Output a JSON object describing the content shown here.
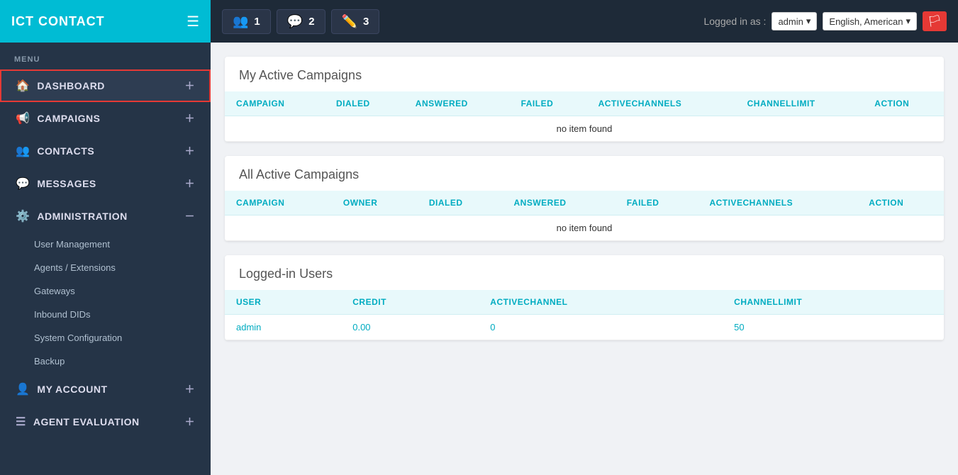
{
  "brand": {
    "title": "ICT CONTACT"
  },
  "header": {
    "nav_items": [
      {
        "icon": "👥",
        "count": "1",
        "id": "nav-users"
      },
      {
        "icon": "💬",
        "count": "2",
        "id": "nav-messages"
      },
      {
        "icon": "✏️",
        "count": "3",
        "id": "nav-edit"
      }
    ],
    "logged_in_label": "Logged in as :",
    "user": "admin",
    "language": "English, American"
  },
  "sidebar": {
    "menu_label": "MENU",
    "items": [
      {
        "id": "dashboard",
        "label": "DASHBOARD",
        "icon": "🏠",
        "action": "plus",
        "active": true
      },
      {
        "id": "campaigns",
        "label": "CAMPAIGNS",
        "icon": "📢",
        "action": "plus"
      },
      {
        "id": "contacts",
        "label": "CONTACTS",
        "icon": "👥",
        "action": "plus"
      },
      {
        "id": "messages",
        "label": "MESSAGES",
        "icon": "💬",
        "action": "plus"
      },
      {
        "id": "administration",
        "label": "ADMINISTRATION",
        "icon": "⚙️",
        "action": "minus"
      }
    ],
    "admin_sub_items": [
      {
        "id": "user-management",
        "label": "User Management"
      },
      {
        "id": "agents-extensions",
        "label": "Agents / Extensions"
      },
      {
        "id": "gateways",
        "label": "Gateways"
      },
      {
        "id": "inbound-dids",
        "label": "Inbound DIDs"
      },
      {
        "id": "system-configuration",
        "label": "System Configuration"
      },
      {
        "id": "backup",
        "label": "Backup"
      }
    ],
    "bottom_items": [
      {
        "id": "my-account",
        "label": "MY ACCOUNT",
        "icon": "👤",
        "action": "plus"
      },
      {
        "id": "agent-evaluation",
        "label": "AGENT EVALUATION",
        "icon": "☰",
        "action": "plus"
      }
    ]
  },
  "my_active_campaigns": {
    "title": "My Active Campaigns",
    "columns": [
      "CAMPAIGN",
      "DIALED",
      "ANSWERED",
      "FAILED",
      "ACTIVECHANNELS",
      "CHANNELLIMIT",
      "ACTION"
    ],
    "no_item_text": "no item found",
    "rows": []
  },
  "all_active_campaigns": {
    "title": "All Active Campaigns",
    "columns": [
      "CAMPAIGN",
      "OWNER",
      "DIALED",
      "ANSWERED",
      "FAILED",
      "ACTIVECHANNELS",
      "ACTION"
    ],
    "no_item_text": "no item found",
    "rows": []
  },
  "logged_in_users": {
    "title": "Logged-in Users",
    "columns": [
      "USER",
      "CREDIT",
      "ACTIVECHANNEL",
      "CHANNELLIMIT"
    ],
    "rows": [
      {
        "user": "admin",
        "credit": "0.00",
        "activechannel": "0",
        "channellimit": "50"
      }
    ]
  }
}
